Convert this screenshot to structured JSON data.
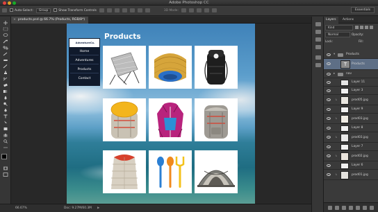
{
  "app": {
    "title": "Adobe Photoshop CC"
  },
  "options": {
    "auto_select_label": "Auto-Select:",
    "auto_select_value": "Group",
    "show_transform_label": "Show Transform Controls",
    "mode_label": "3D Mode:",
    "workspace": "Essentials"
  },
  "document": {
    "tab_label": "products.psd @ 66.7% (Products, RGB/8*)"
  },
  "page": {
    "brand": "AdventureCo.",
    "nav": [
      "Home",
      "Adventures",
      "Products",
      "Contact"
    ],
    "title": "Products"
  },
  "status": {
    "zoom": "66.67%",
    "doc": "Doc: 9.27M/60.3M"
  },
  "layers_panel": {
    "tabs": [
      "Layers",
      "Actions"
    ],
    "filter_label": "Kind",
    "blend_mode": "Normal",
    "opacity_label": "Opacity:",
    "lock_label": "Lock:",
    "fill_label": "Fill:",
    "layers": [
      {
        "name": "Products",
        "kind": "group"
      },
      {
        "name": "Products",
        "kind": "text",
        "selected": true
      },
      {
        "name": "nav",
        "kind": "group"
      },
      {
        "name": "Layer 11",
        "kind": "image"
      },
      {
        "name": "Layer 3",
        "kind": "image"
      },
      {
        "name": "prod05.jpg",
        "kind": "image"
      },
      {
        "name": "Layer 9",
        "kind": "image"
      },
      {
        "name": "prod03.jpg",
        "kind": "image"
      },
      {
        "name": "Layer 8",
        "kind": "image"
      },
      {
        "name": "prod03.jpg",
        "kind": "image"
      },
      {
        "name": "Layer 7",
        "kind": "image"
      },
      {
        "name": "prod02.jpg",
        "kind": "image"
      },
      {
        "name": "Layer 6",
        "kind": "image"
      },
      {
        "name": "prod01.jpg",
        "kind": "image"
      }
    ]
  },
  "colors": {
    "app_bg": "#2b2b2b",
    "panel": "#3a3a3a",
    "selection": "#5e6f86",
    "nav_bg": "#101a2c"
  }
}
